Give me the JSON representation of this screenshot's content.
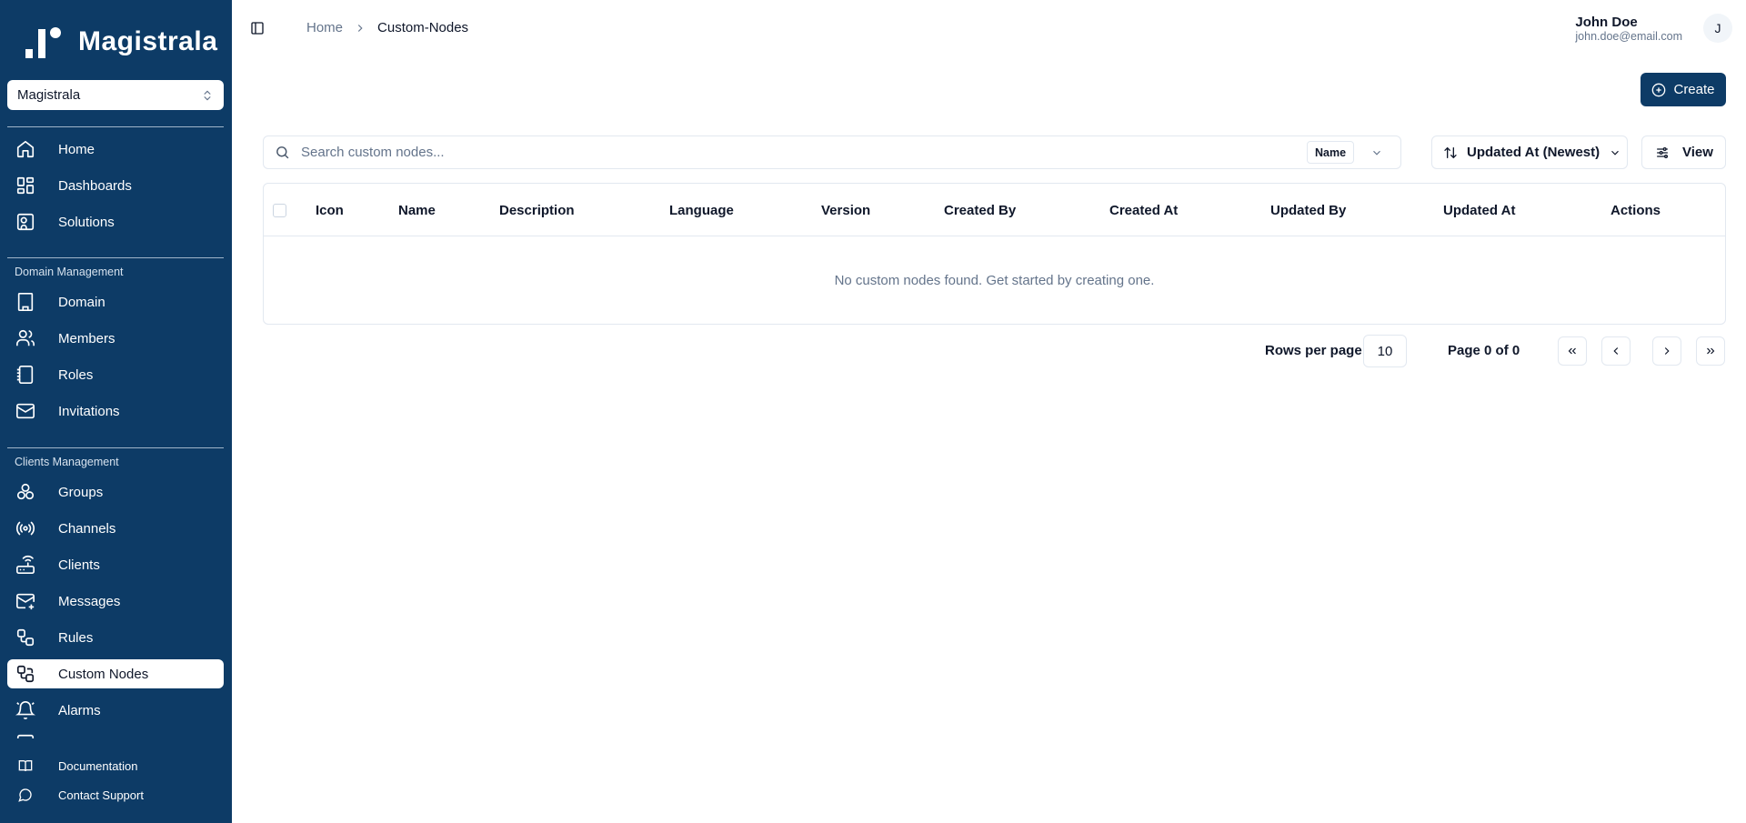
{
  "app": {
    "name": "Magistrala",
    "workspace": "Magistrala"
  },
  "sidebar": {
    "main_items": [
      {
        "label": "Home",
        "icon": "home-icon"
      },
      {
        "label": "Dashboards",
        "icon": "dashboard-icon"
      },
      {
        "label": "Solutions",
        "icon": "solutions-icon"
      }
    ],
    "domain_section": "Domain Management",
    "domain_items": [
      {
        "label": "Domain",
        "icon": "building-icon"
      },
      {
        "label": "Members",
        "icon": "users-icon"
      },
      {
        "label": "Roles",
        "icon": "notebook-icon"
      },
      {
        "label": "Invitations",
        "icon": "mail-icon"
      }
    ],
    "clients_section": "Clients Management",
    "clients_items": [
      {
        "label": "Groups",
        "icon": "groups-icon"
      },
      {
        "label": "Channels",
        "icon": "radio-icon"
      },
      {
        "label": "Clients",
        "icon": "router-icon"
      },
      {
        "label": "Messages",
        "icon": "mail-open-icon"
      },
      {
        "label": "Rules",
        "icon": "workflow-icon"
      },
      {
        "label": "Custom Nodes",
        "icon": "custom-nodes-icon"
      },
      {
        "label": "Alarms",
        "icon": "bell-icon"
      }
    ],
    "footer_items": [
      {
        "label": "Documentation",
        "icon": "book-icon"
      },
      {
        "label": "Contact Support",
        "icon": "message-circle-icon"
      }
    ]
  },
  "header": {
    "breadcrumb": [
      "Home",
      "Custom-Nodes"
    ],
    "user_name": "John Doe",
    "user_email": "john.doe@email.com",
    "avatar_initial": "J"
  },
  "toolbar": {
    "create_label": "Create",
    "search_placeholder": "Search custom nodes...",
    "search_field": "Name",
    "sort_label": "Updated At (Newest)",
    "view_label": "View"
  },
  "table": {
    "columns": [
      "Icon",
      "Name",
      "Description",
      "Language",
      "Version",
      "Created By",
      "Created At",
      "Updated By",
      "Updated At",
      "Actions"
    ],
    "empty_message": "No custom nodes found. Get started by creating one."
  },
  "pagination": {
    "rows_label": "Rows per page",
    "rows_value": "10",
    "page_label": "Page 0 of 0"
  },
  "colors": {
    "sidebar_bg": "#0d3b66",
    "accent": "#0d3b66"
  }
}
